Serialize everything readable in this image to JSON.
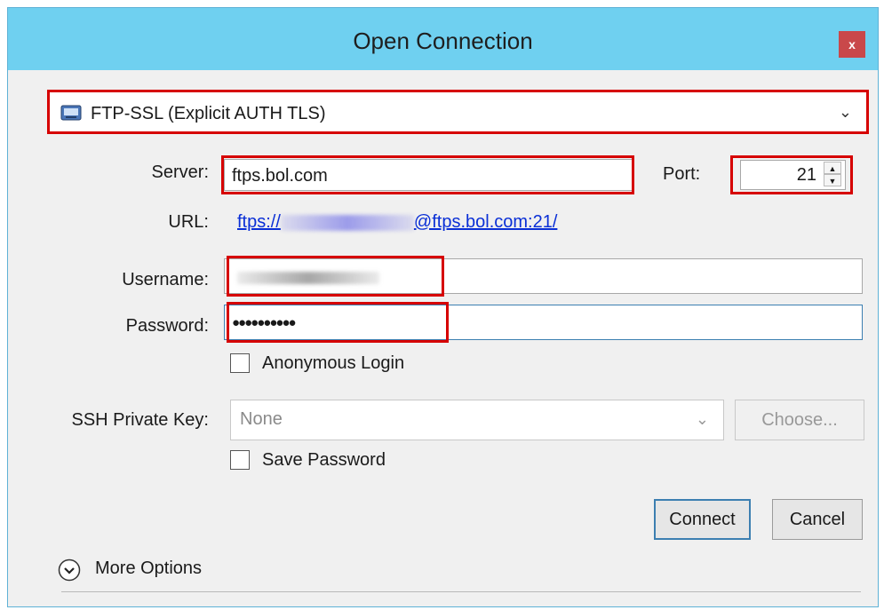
{
  "window": {
    "title": "Open Connection",
    "close_label": "x"
  },
  "protocol": {
    "selected": "FTP-SSL (Explicit AUTH TLS)",
    "icon": "drive-icon"
  },
  "server": {
    "label": "Server:",
    "value": "ftps.bol.com"
  },
  "port": {
    "label": "Port:",
    "value": "21"
  },
  "url": {
    "label": "URL:",
    "prefix": "ftps://",
    "suffix": "@ftps.bol.com:21/"
  },
  "username": {
    "label": "Username:",
    "value": ""
  },
  "password": {
    "label": "Password:",
    "masked_value": "●●●●●●●●●●"
  },
  "anonymous_login": {
    "label": "Anonymous Login",
    "checked": false
  },
  "ssh_key": {
    "label": "SSH Private Key:",
    "selected": "None",
    "choose_label": "Choose..."
  },
  "save_password": {
    "label": "Save Password",
    "checked": false
  },
  "buttons": {
    "connect": "Connect",
    "cancel": "Cancel"
  },
  "more_options": {
    "label": "More Options"
  },
  "colors": {
    "titlebar": "#6fd0f0",
    "highlight": "#d60000",
    "link": "#0a2fd6",
    "close": "#c9484a"
  }
}
